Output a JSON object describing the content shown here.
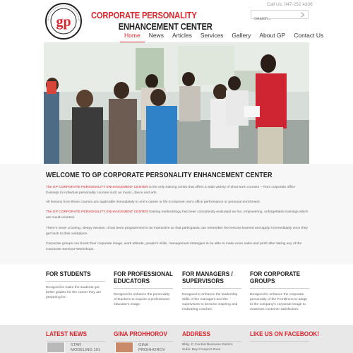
{
  "header": {
    "call_us": "Call Us: 047-252 4336",
    "brand_line1": "CORPORATE PERSONALITY",
    "brand_line2": "ENHANCEMENT CENTER",
    "logo": {
      "letters": "gp",
      "ring_text": "CORPORATE PERSONALITY ENHANCEMENT CENTER"
    },
    "search": {
      "placeholder": "Search..."
    }
  },
  "nav": {
    "items": [
      {
        "label": "Home",
        "active": true
      },
      {
        "label": "News",
        "active": false
      },
      {
        "label": "Articles",
        "active": false
      },
      {
        "label": "Services",
        "active": false
      },
      {
        "label": "Gallery",
        "active": false
      },
      {
        "label": "About GP",
        "active": false
      },
      {
        "label": "Contact Us",
        "active": false
      }
    ]
  },
  "welcome": {
    "title": "WELCOME TO GP CORPORATE PERSONALITY ENHANCEMENT CENTER",
    "p1_highlight": "The GP CORPORATE PERSONALITY ENHANCEMENT CENTER",
    "p1_rest": " is the only training center that offers a wide variety of short term courses ---from corporate office trainings to individual personality courses such as music, dance and arts.",
    "p2": "All lessons from these courses are applicable immediately to one's career or life to improve one's office performance or personal enrichment.",
    "p3_highlight": "The GP CORPORATE PERSONALITY ENHANCEMENT CENTER",
    "p3_rest": " training methodology has been consistently evaluated as fun, empowering, unforgettable trainings which are result-oriented.",
    "p4": "There's never a boring, sleepy session. It has been programmed to be interactive so that participants can remember the lessons learned and apply it immediately once they get back to their workplace.",
    "p5": "Corporate groups can boost their corporate image, work attitude, people's skills, management strategies to be able to make more sales and profit after taking any of the Corporate Seminar-Workshops."
  },
  "columns": [
    {
      "title_line1": "FOR STUDENTS",
      "title_line2": "",
      "text": "Designed to make the students get better grades for the career they are preparing for."
    },
    {
      "title_line1": "FOR PROFESSIONAL",
      "title_line2": "EDUCATORS",
      "text": "Designed to enhance the personality of teachers to acquire a professional educator's image."
    },
    {
      "title_line1": "FOR MANAGERS /",
      "title_line2": "SUPERVISORS",
      "text": "Designed to enhance the leadership skills of the managers and the supervisors to become inspiring and motivating coaches."
    },
    {
      "title_line1": "FOR CORPORATE",
      "title_line2": "GROUPS",
      "text": "Designed to enhance the corporate personality of the Frontliners to adapt to the company's corporate image to maximize customer satisfaction."
    }
  ],
  "footer": {
    "latest_news": {
      "title": "LATEST NEWS",
      "item": "STAR",
      "item2": "MODELING 101"
    },
    "person": {
      "title": "GINA PROHHOROV",
      "item": "GINA",
      "item2": "PROHHOROV"
    },
    "address": {
      "title": "ADDRESS",
      "line1": "Bldg. P, Central Business District,",
      "line2": "Subic Bay Freeport Zone"
    },
    "facebook": {
      "title": "LIKE US ON FACEBOOK!"
    }
  },
  "colors": {
    "accent": "#d8262e",
    "text": "#555555",
    "heading": "#222222",
    "band": "#f7f7f7",
    "footer": "#e8e8e8"
  },
  "hero": {
    "image": "classroom training photo"
  }
}
